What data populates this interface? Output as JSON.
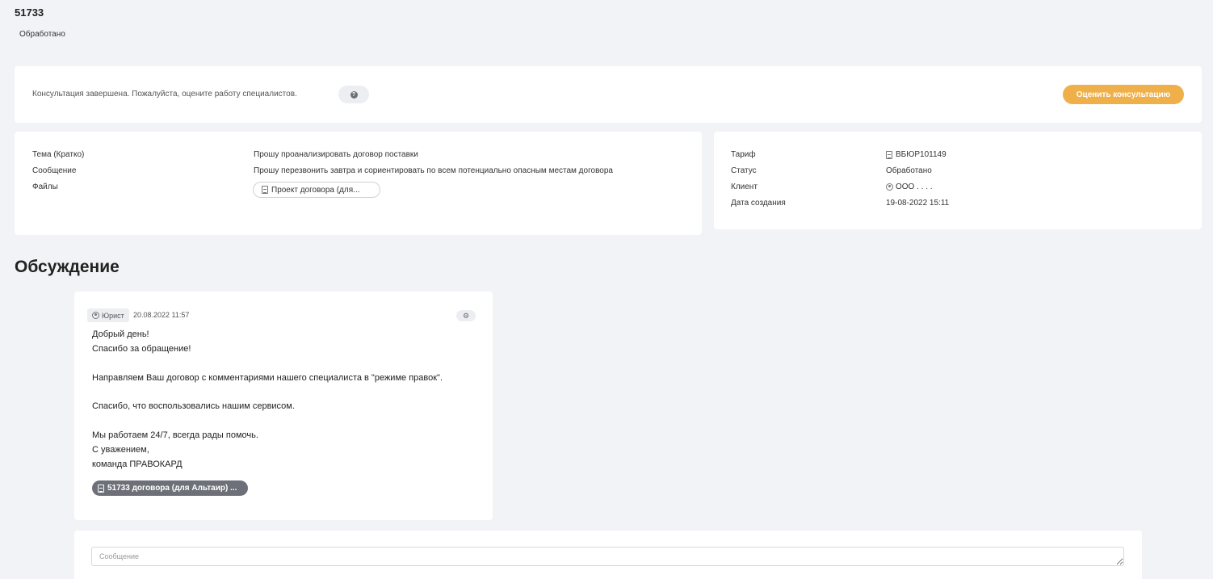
{
  "header": {
    "id": "51733",
    "status": "Обработано"
  },
  "notice": {
    "text": "Консультация завершена. Пожалуйста, оцените работу специалистов.",
    "help_icon": "question-icon",
    "rate_button": "Оценить консультацию",
    "accent": "#efb04a"
  },
  "details": {
    "topic_label": "Тема (Кратко)",
    "topic_value": "Прошу проанализировать договор поставки",
    "message_label": "Сообщение",
    "message_value": "Прошу перезвонить завтра и сориентировать по всем потенциально опасным местам договора",
    "files_label": "Файлы",
    "file_name": "Проект договора (для..."
  },
  "info": {
    "tariff_label": "Тариф",
    "tariff_value": "ВБЮР101149",
    "status_label": "Статус",
    "status_value": "Обработано",
    "client_label": "Клиент",
    "client_value": "ООО . . . .",
    "created_label": "Дата создания",
    "created_value": "19-08-2022 15:11"
  },
  "discussion": {
    "title": "Обсуждение",
    "message": {
      "author": "Юрист",
      "time": "20.08.2022 11:57",
      "lines": [
        "Добрый день!",
        "Спасибо за обращение!",
        "Направляем Ваш договор с комментариями нашего специалиста в \"режиме правок\".",
        "Спасибо, что воспользовались нашим сервисом.",
        "Мы работаем 24/7, всегда рады помочь.",
        "С уважением,",
        "команда ПРАВОКАРД"
      ],
      "attachment": "51733 договора (для Альтаир) ..."
    }
  },
  "composer": {
    "placeholder": "Сообщение"
  }
}
